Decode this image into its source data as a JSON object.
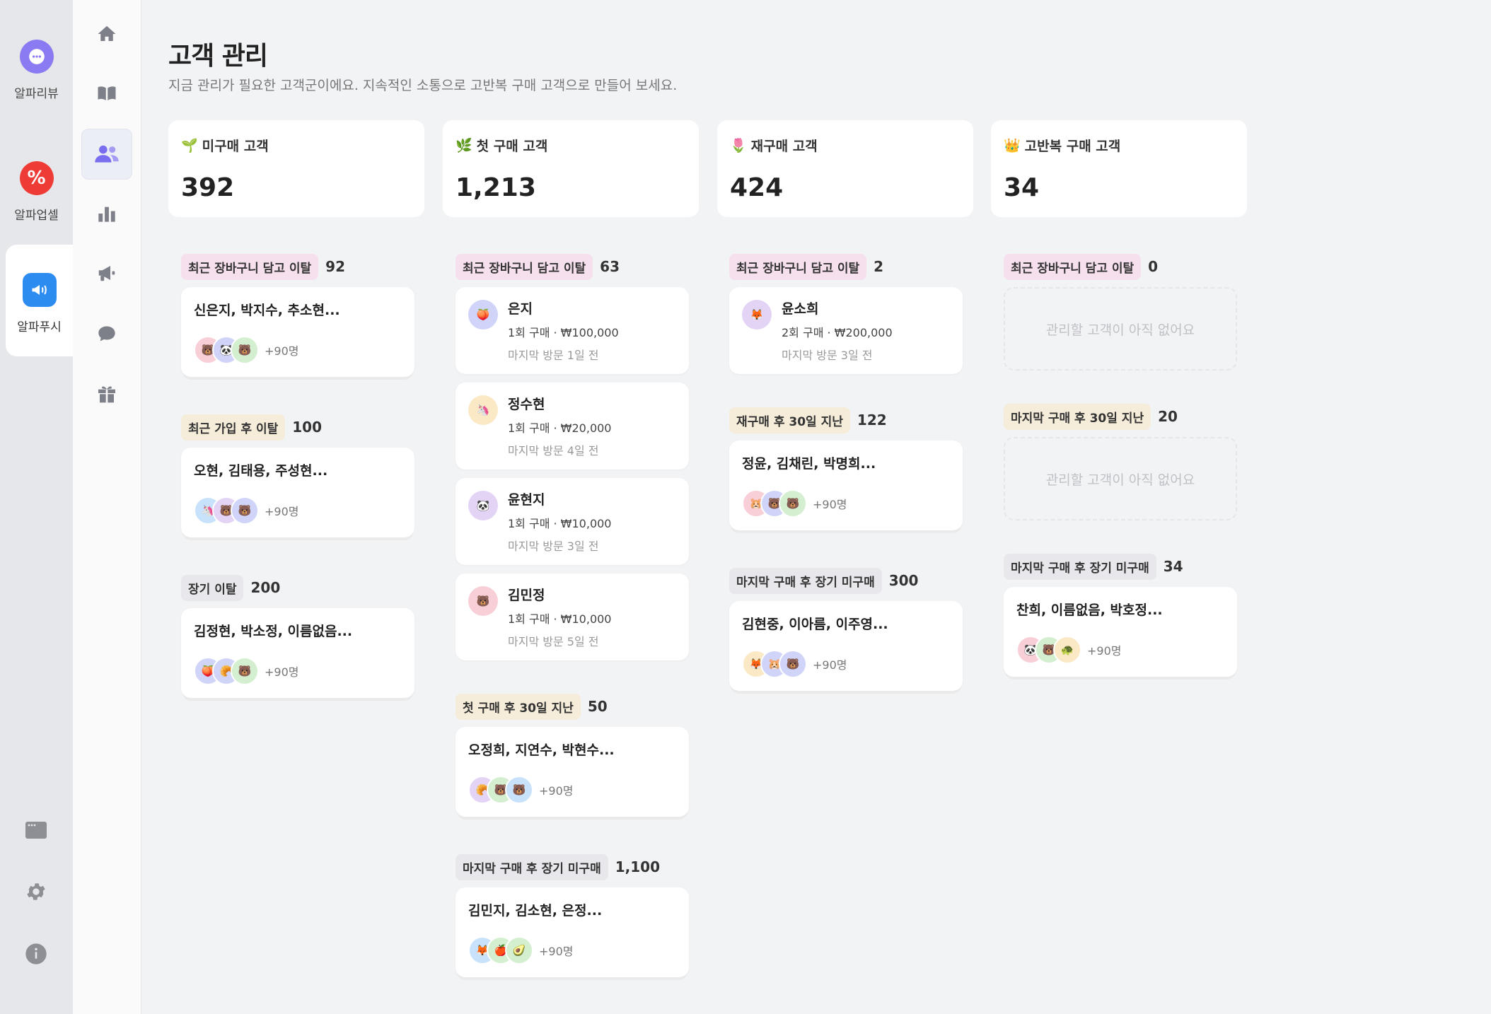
{
  "apps": [
    {
      "label": "알파리뷰",
      "icon": "chat-bubble-icon"
    },
    {
      "label": "알파업셀",
      "icon": "percent-badge-icon"
    },
    {
      "label": "알파푸시",
      "icon": "megaphone-icon"
    }
  ],
  "page": {
    "title": "고객 관리",
    "subtitle": "지금 관리가 필요한 고객군이에요. 지속적인 소통으로 고반복 구매 고객으로 만들어 보세요."
  },
  "stats": [
    {
      "emoji": "🌱",
      "label": "미구매 고객",
      "value": "392"
    },
    {
      "emoji": "🌿",
      "label": "첫 구매 고객",
      "value": "1,213"
    },
    {
      "emoji": "🌷",
      "label": "재구매 고객",
      "value": "424"
    },
    {
      "emoji": "👑",
      "label": "고반복 구매 고객",
      "value": "34"
    }
  ],
  "columns": [
    {
      "groups": [
        {
          "tag": "최근 장바구니 담고 이탈",
          "count": "92",
          "names": "신은지, 박지수, 추소현...",
          "more": "+90명"
        },
        {
          "tag": "최근 가입 후 이탈",
          "count": "100",
          "names": "오현, 김태용, 주성현...",
          "more": "+90명"
        },
        {
          "tag": "장기 이탈",
          "count": "200",
          "names": "김정현, 박소정, 이름없음...",
          "more": "+90명"
        }
      ]
    },
    {
      "cart": {
        "tag": "최근 장바구니 담고 이탈",
        "count": "63"
      },
      "people": [
        {
          "name": "은지",
          "meta": "1회 구매 · ₩100,000",
          "visit": "마지막 방문 1일 전"
        },
        {
          "name": "정수현",
          "meta": "1회 구매 · ₩20,000",
          "visit": "마지막 방문 4일 전"
        },
        {
          "name": "윤현지",
          "meta": "1회 구매 · ₩10,000",
          "visit": "마지막 방문 3일 전"
        },
        {
          "name": "김민정",
          "meta": "1회 구매 · ₩10,000",
          "visit": "마지막 방문 5일 전"
        }
      ],
      "groups": [
        {
          "tag": "첫 구매 후 30일 지난",
          "count": "50",
          "names": "오정희, 지연수, 박현수...",
          "more": "+90명"
        },
        {
          "tag": "마지막 구매 후 장기 미구매",
          "count": "1,100",
          "names": "김민지, 김소현, 은정...",
          "more": "+90명"
        }
      ]
    },
    {
      "cart": {
        "tag": "최근 장바구니 담고 이탈",
        "count": "2"
      },
      "people": [
        {
          "name": "윤소희",
          "meta": "2회 구매 · ₩200,000",
          "visit": "마지막 방문 3일 전"
        }
      ],
      "groups": [
        {
          "tag": "재구매 후 30일 지난",
          "count": "122",
          "names": "정윤, 김채린, 박명희...",
          "more": "+90명"
        },
        {
          "tag": "마지막 구매 후 장기 미구매",
          "count": "300",
          "names": "김현중, 이아름, 이주영...",
          "more": "+90명"
        }
      ]
    },
    {
      "groups": [
        {
          "tag": "최근 장바구니 담고 이탈",
          "count": "0",
          "empty": "관리할 고객이 아직 없어요"
        },
        {
          "tag": "마지막 구매 후 30일 지난",
          "count": "20",
          "empty": "관리할 고객이 아직 없어요"
        },
        {
          "tag": "마지막 구매 후 장기 미구매",
          "count": "34",
          "names": "찬희, 이름없음, 박호정...",
          "more": "+90명"
        }
      ]
    }
  ],
  "avatar_glyphs": {
    "bear": "🐻",
    "panda": "🐼",
    "unicorn": "🦄",
    "fox": "🦊",
    "peach": "🍑",
    "croissant": "🥐",
    "hamster": "🐹",
    "turtle": "🐢",
    "apple": "🍎",
    "avocado": "🥑"
  }
}
